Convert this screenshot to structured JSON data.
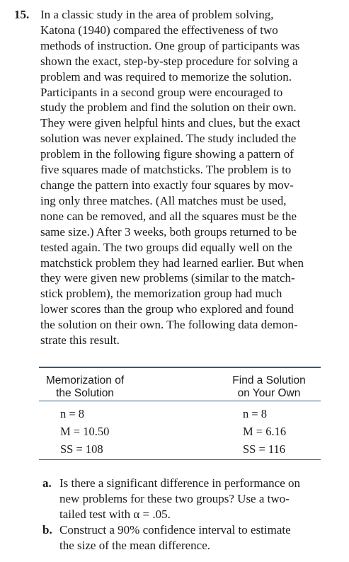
{
  "problem": {
    "number": "15.",
    "lines": [
      "In a classic study in the area of problem solving,",
      "Katona (1940) compared the effectiveness of two",
      "methods of instruction. One group of participants was",
      "shown the exact, step-by-step procedure for solving a",
      "problem and was required to memorize the solution.",
      "Participants in a second group were encouraged to",
      "study the problem and find the solution on their own.",
      "They were given helpful hints and clues, but the exact",
      "solution was never explained. The study included the",
      "problem in the following figure showing a pattern of",
      "five squares made of matchsticks. The problem is to",
      "change the pattern into exactly four squares by mov-",
      "ing only three matches. (All matches must be used,",
      "none can be removed, and all the squares must be the",
      "same size.) After 3 weeks, both groups returned to be",
      "tested again. The two groups did equally well on the",
      "matchstick problem they had learned earlier. But when",
      "they were given new problems (similar to the match-",
      "stick problem), the memorization group had much",
      "lower scores than the group who explored and found",
      "the solution on their own. The following data demon-",
      "strate this result."
    ]
  },
  "table": {
    "col1_header": [
      "Memorization of",
      "the Solution"
    ],
    "col2_header": [
      "Find a Solution",
      "on Your Own"
    ],
    "rows": [
      {
        "c1": "n = 8",
        "c2": "n = 8"
      },
      {
        "c1": "M = 10.50",
        "c2": "M = 6.16"
      },
      {
        "c1": "SS = 108",
        "c2": "SS = 116"
      }
    ]
  },
  "questions": [
    {
      "label": "a.",
      "lines": [
        "Is there a significant difference in performance on",
        "new problems for these two groups? Use a two-",
        "tailed test with α = .05."
      ]
    },
    {
      "label": "b.",
      "lines": [
        "Construct a 90% confidence interval to estimate",
        "the size of the mean difference."
      ]
    }
  ]
}
